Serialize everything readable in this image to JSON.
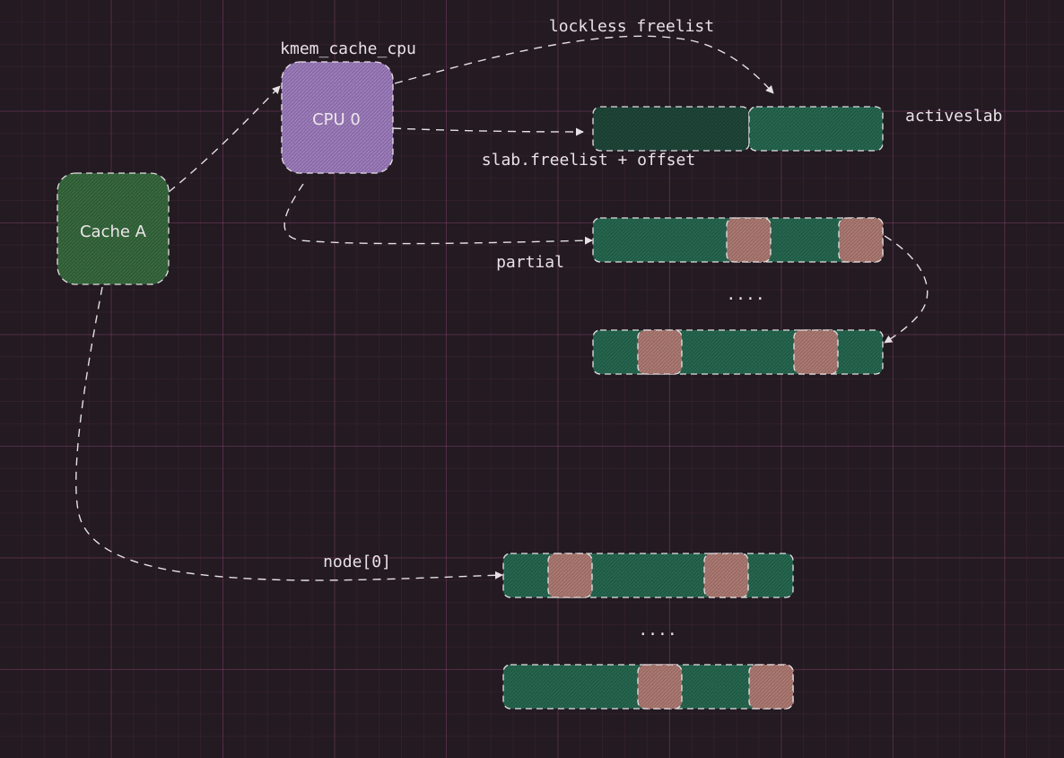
{
  "nodes": {
    "cache": {
      "label": "Cache A"
    },
    "cpu": {
      "label": "CPU 0",
      "caption": "kmem_cache_cpu"
    }
  },
  "labels": {
    "lockless": "lockless freelist",
    "freelist_offset": "slab.freelist + offset",
    "activeslab": "activeslab",
    "partial": "partial",
    "node": "node[0]",
    "ellipsis_partial": "....",
    "ellipsis_node": "...."
  },
  "colors": {
    "background": "#231a22",
    "cache_fill": "#2e5a34",
    "cpu_fill": "#8a6aa8",
    "slab_fill": "#1f5a45",
    "slab_dark_fill": "#1a3d31",
    "used_object_fill": "#9a6a64",
    "stroke": "#e6e0e4"
  }
}
